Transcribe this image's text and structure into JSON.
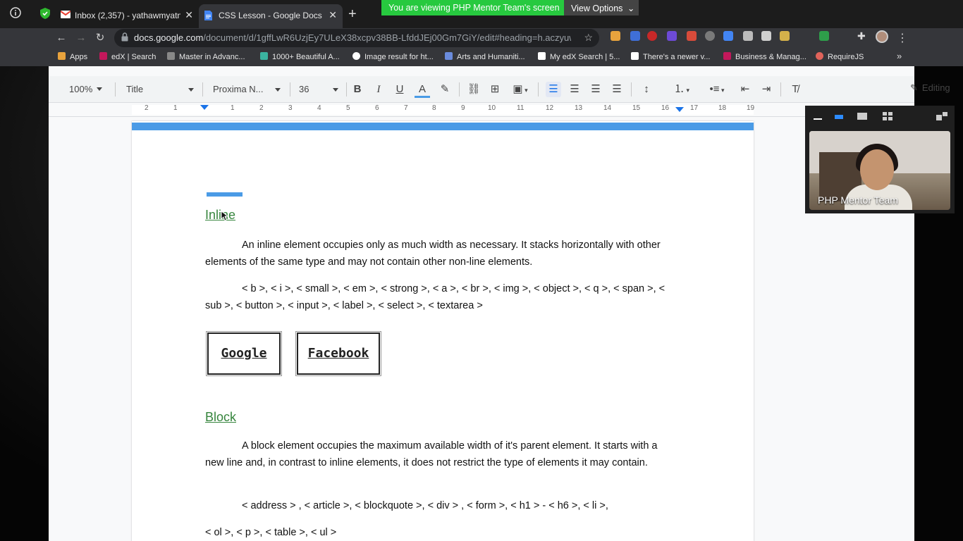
{
  "browser": {
    "tabs": [
      {
        "title": "Inbox (2,357) - yathawmyatnoe",
        "favicon": "gmail-icon"
      },
      {
        "title": "CSS Lesson - Google Docs",
        "favicon": "google-docs-icon"
      }
    ],
    "new_tab": "+",
    "share_banner": "You are viewing PHP Mentor Team's screen",
    "view_options": "View Options",
    "url_domain": "docs.google.com",
    "url_path": "/document/d/1gffLwR6UzjEy7ULeX38xcpv38BB-LfddJEj00Gm7GiY/edit#heading=h.aczyuw...",
    "bookmarks": [
      {
        "label": "Apps",
        "icon": "apps-grid-icon",
        "color": "#e8a33d"
      },
      {
        "label": "edX | Search",
        "icon": "edx-icon",
        "color": "#c2185b"
      },
      {
        "label": "Master in Advanc...",
        "icon": "dash-icon",
        "color": "#888888"
      },
      {
        "label": "1000+ Beautiful A...",
        "icon": "canva-icon",
        "color": "#3bb4a0"
      },
      {
        "label": "Image result for ht...",
        "icon": "google-icon",
        "color": "#ffffff"
      },
      {
        "label": "Arts and Humaniti...",
        "icon": "link-icon",
        "color": "#6a8bdc"
      },
      {
        "label": "My edX Search | 5...",
        "icon": "edx-icon",
        "color": "#ffffff"
      },
      {
        "label": "There's a newer v...",
        "icon": "bootstrap-icon",
        "color": "#ffffff"
      },
      {
        "label": "Business & Manag...",
        "icon": "edx-icon",
        "color": "#c2185b"
      },
      {
        "label": "RequireJS",
        "icon": "requirejs-icon",
        "color": "#e0635a"
      }
    ],
    "bookmarks_more": "»"
  },
  "toolbar": {
    "zoom": "100%",
    "style": "Title",
    "font": "Proxima N...",
    "size": "36",
    "mode": "Editing"
  },
  "ruler": {
    "numbers": [
      "2",
      "1",
      "1",
      "2",
      "3",
      "4",
      "5",
      "6",
      "7",
      "8",
      "9",
      "10",
      "11",
      "12",
      "13",
      "14",
      "15",
      "16",
      "17",
      "18",
      "19"
    ]
  },
  "document": {
    "inline_heading": "Inline",
    "inline_desc": "An inline element occupies only as much width as necessary. It stacks horizontally with other elements of the same type and may not contain other non-line elements.",
    "inline_tags": "< b >, < i >, < small >, < em >, < strong >, < a >,  < br >, < img >, < object >, < q >,  < span >, < sub >, < button >, < input >, < label >, < select >, < textarea >",
    "example_buttons": [
      "Google",
      "Facebook"
    ],
    "block_heading": "Block",
    "block_desc": "A block element occupies the maximum available width of it's parent element. It starts with a new line and, in contrast to inline elements, it does not restrict the type of elements it may contain.",
    "block_tags_1": "< address > , < article >, < blockquote >, < div > , < form >, < h1 > - < h6 >, < li >,",
    "block_tags_2": "< ol >, < p >, < table >, < ul >"
  },
  "video": {
    "participant": "PHP Mentor Team"
  },
  "colors": {
    "share_banner": "#27c93f",
    "accent_blue": "#4a9be6",
    "heading_green": "#36853d"
  }
}
